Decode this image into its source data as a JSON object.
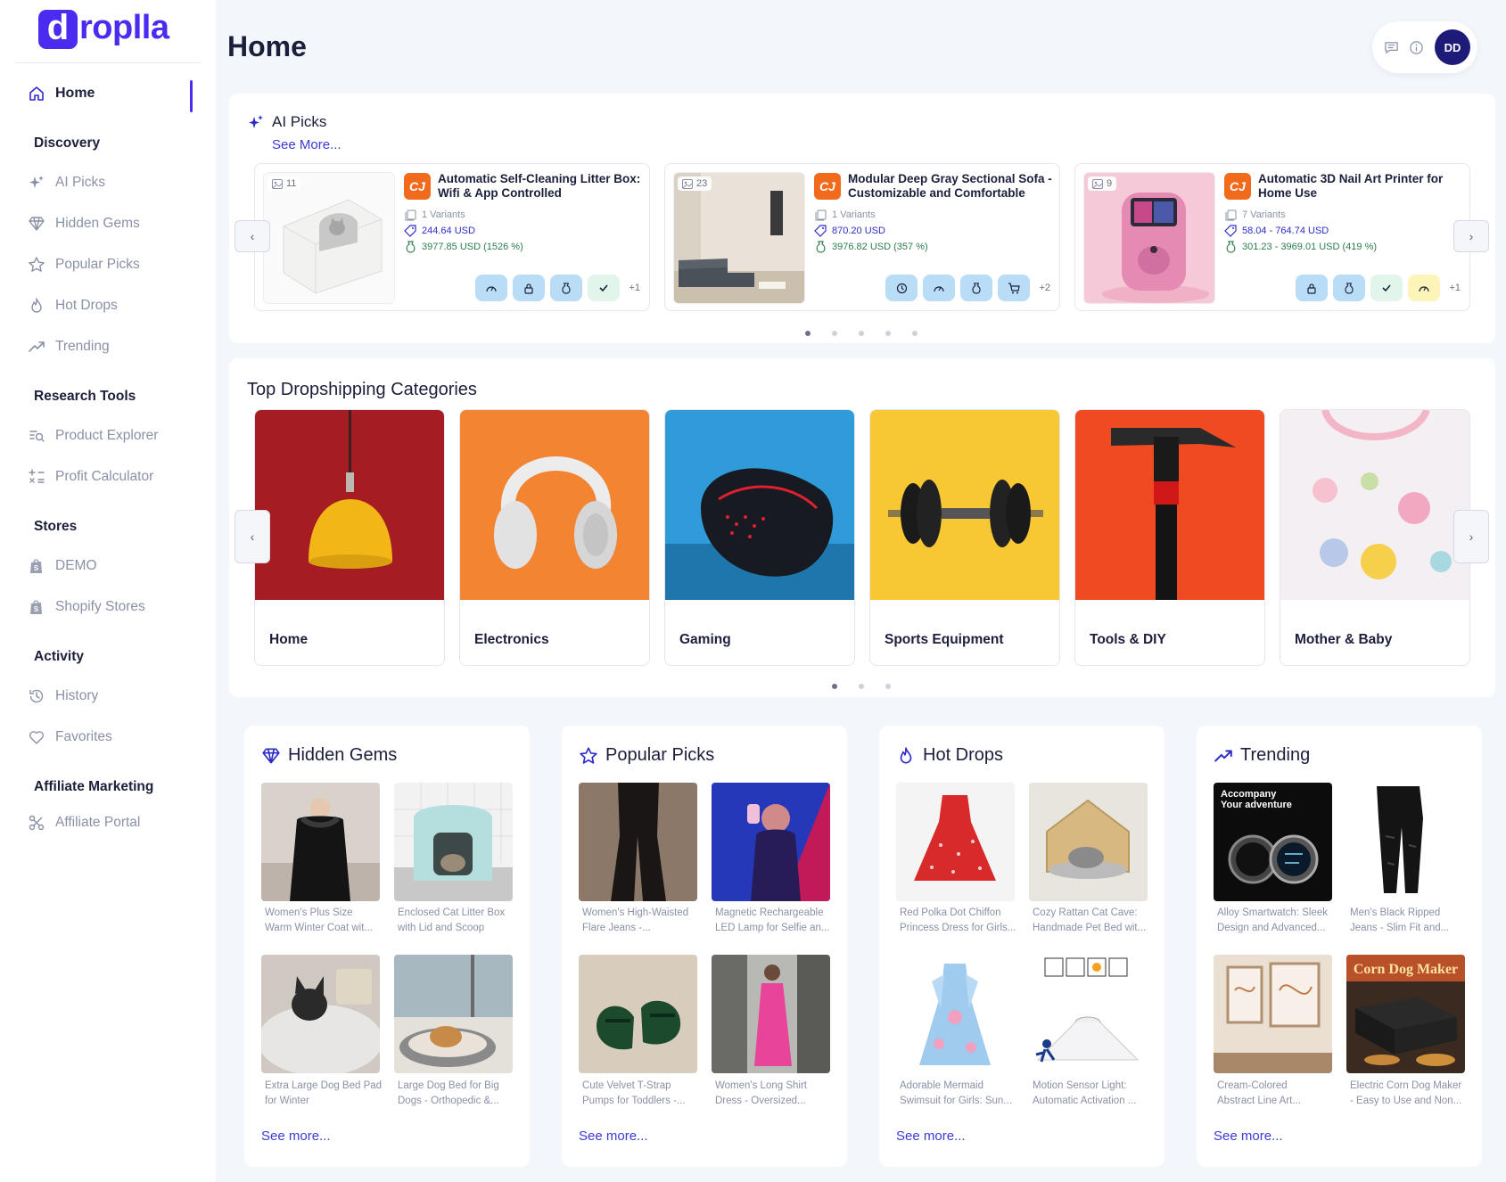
{
  "brand": {
    "mark": "d",
    "name": "roplla",
    "color": "#4b2bf0"
  },
  "sidebar": {
    "home": "Home",
    "sections": [
      {
        "title": "Discovery",
        "items": [
          "AI Picks",
          "Hidden Gems",
          "Popular Picks",
          "Hot Drops",
          "Trending"
        ]
      },
      {
        "title": "Research Tools",
        "items": [
          "Product Explorer",
          "Profit Calculator"
        ]
      },
      {
        "title": "Stores",
        "items": [
          "DEMO",
          "Shopify Stores"
        ]
      },
      {
        "title": "Activity",
        "items": [
          "History",
          "Favorites"
        ]
      },
      {
        "title": "Affiliate Marketing",
        "items": [
          "Affiliate Portal"
        ]
      }
    ]
  },
  "header": {
    "title": "Home",
    "avatar": "DD"
  },
  "ai_picks": {
    "title": "AI Picks",
    "see_more": "See More...",
    "products": [
      {
        "images": "11",
        "title": "Automatic Self-Cleaning Litter Box: Wifi & App Controlled",
        "variants": "1 Variants",
        "price": "244.64 USD",
        "profit": "3977.85 USD (1526 %)",
        "more": "+1"
      },
      {
        "images": "23",
        "title": "Modular Deep Gray Sectional Sofa - Customizable and Comfortable",
        "variants": "1 Variants",
        "price": "870.20 USD",
        "profit": "3976.82 USD (357 %)",
        "more": "+2"
      },
      {
        "images": "9",
        "title": "Automatic 3D Nail Art Printer for Home Use",
        "variants": "7 Variants",
        "price": "58.04 - 764.74 USD",
        "profit": "301.23 - 3969.01 USD (419 %)",
        "more": "+1"
      }
    ]
  },
  "categories": {
    "title": "Top Dropshipping Categories",
    "items": [
      "Home",
      "Electronics",
      "Gaming",
      "Sports Equipment",
      "Tools & DIY",
      "Mother & Baby"
    ]
  },
  "sections": {
    "hidden_gems": {
      "title": "Hidden Gems",
      "see_more": "See more...",
      "items": [
        {
          "line1": "Women's Plus Size",
          "line2": "Warm Winter Coat wit..."
        },
        {
          "line1": "Enclosed Cat Litter Box",
          "line2": "with Lid and Scoop"
        },
        {
          "line1": "Extra Large Dog Bed Pad",
          "line2": "for Winter"
        },
        {
          "line1": "Large Dog Bed for Big",
          "line2": "Dogs - Orthopedic &..."
        }
      ]
    },
    "popular_picks": {
      "title": "Popular Picks",
      "see_more": "See more...",
      "items": [
        {
          "line1": "Women's High-Waisted",
          "line2": "Flare Jeans -..."
        },
        {
          "line1": "Magnetic Rechargeable",
          "line2": "LED Lamp for Selfie an..."
        },
        {
          "line1": "Cute Velvet T-Strap",
          "line2": "Pumps for Toddlers -..."
        },
        {
          "line1": "Women's Long Shirt",
          "line2": "Dress - Oversized..."
        }
      ]
    },
    "hot_drops": {
      "title": "Hot Drops",
      "see_more": "See more...",
      "items": [
        {
          "line1": "Red Polka Dot Chiffon",
          "line2": "Princess Dress for Girls..."
        },
        {
          "line1": "Cozy Rattan Cat Cave:",
          "line2": "Handmade Pet Bed wit..."
        },
        {
          "line1": "Adorable Mermaid",
          "line2": "Swimsuit for Girls: Sun..."
        },
        {
          "line1": "Motion Sensor Light:",
          "line2": "Automatic Activation ..."
        }
      ]
    },
    "trending": {
      "title": "Trending",
      "see_more": "See more...",
      "items": [
        {
          "line1": "Alloy Smartwatch: Sleek",
          "line2": "Design and Advanced..."
        },
        {
          "line1": "Men's Black Ripped",
          "line2": "Jeans - Slim Fit and..."
        },
        {
          "line1": "Cream-Colored",
          "line2": "Abstract Line Art..."
        },
        {
          "line1": "Electric Corn Dog Maker",
          "line2": "- Easy to Use and Non..."
        }
      ]
    }
  },
  "image_text": {
    "watch_ad_l1": "Accompany",
    "watch_ad_l2": "Your adventure",
    "corn_dog_banner": "Corn Dog Maker"
  }
}
